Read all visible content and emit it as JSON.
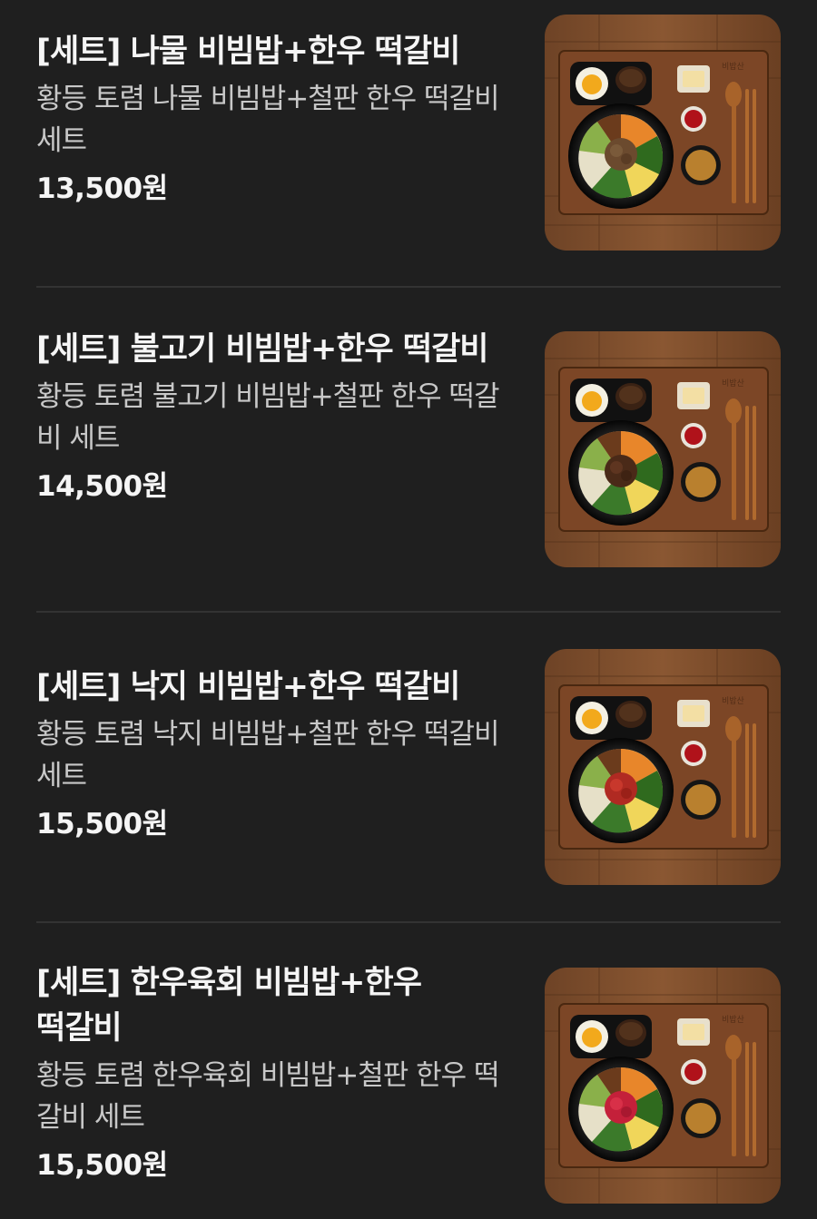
{
  "menu_items": [
    {
      "title": "[세트] 나물 비빔밥+한우 떡갈비",
      "description": "황등 토렴 나물 비빔밥+철판 한우 떡갈비 세트",
      "price": "13,500원",
      "image": "bibimbap-set-photo",
      "topping": "vegetable"
    },
    {
      "title": "[세트] 불고기 비빔밥+한우 떡갈비",
      "description": "황등 토렴 불고기 비빔밥+철판 한우 떡갈비 세트",
      "price": "14,500원",
      "image": "bibimbap-set-photo",
      "topping": "bulgogi"
    },
    {
      "title": "[세트] 낙지 비빔밥+한우 떡갈비",
      "description": "황등 토렴 낙지 비빔밥+철판 한우 떡갈비 세트",
      "price": "15,500원",
      "image": "bibimbap-set-photo",
      "topping": "octopus"
    },
    {
      "title": "[세트] 한우육회 비빔밥+한우 떡갈비",
      "description": "황등 토렴 한우육회 비빔밥+철판 한우 떡갈비 세트",
      "price": "15,500원",
      "image": "bibimbap-set-photo",
      "topping": "yukhoe"
    }
  ],
  "colors": {
    "background": "#1f1f1f",
    "divider": "#333333",
    "title": "#f5f5f5",
    "description": "#c8c8c8"
  }
}
